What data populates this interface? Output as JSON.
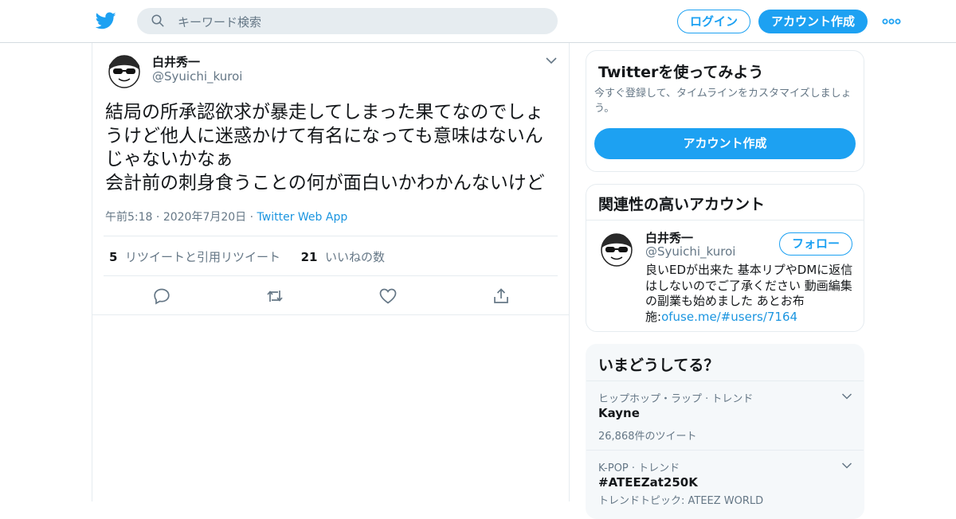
{
  "header": {
    "search_placeholder": "キーワード検索",
    "login_label": "ログイン",
    "signup_label": "アカウント作成"
  },
  "tweet": {
    "author_name": "白井秀一",
    "author_handle": "@Syuichi_kuroi",
    "text": "結局の所承認欲求が暴走してしまった果てなのでしょうけど他人に迷惑かけて有名になっても意味はないんじゃないかなぁ\n会計前の刺身食うことの何が面白いかわかんないけど",
    "time": "午前5:18",
    "date": "2020年7月20日",
    "source": "Twitter Web App",
    "retweet_count": "5",
    "retweet_label": "リツイートと引用リツイート",
    "like_count": "21",
    "like_label": "いいねの数"
  },
  "sidebar": {
    "signup_card": {
      "title": "Twitterを使ってみよう",
      "description": "今すぐ登録して、タイムラインをカスタマイズしましょう。",
      "button": "アカウント作成"
    },
    "related": {
      "title": "関連性の高いアカウント",
      "name": "白井秀一",
      "handle": "@Syuichi_kuroi",
      "follow_label": "フォロー",
      "bio": "良いEDが出来た 基本リプやDMに返信はしないのでご了承ください 動画編集の副業も始めました あとお布施:",
      "bio_link": "ofuse.me/#users/7164"
    },
    "trends": {
      "title": "いまどうしてる？",
      "items": [
        {
          "context": "ヒップホップ・ラップ · トレンド",
          "name": "Kayne",
          "count": "26,868件のツイート"
        },
        {
          "context": "K-POP · トレンド",
          "name": "#ATEEZat250K",
          "count": "トレンドトピック: ATEEZ WORLD"
        }
      ]
    }
  },
  "colors": {
    "brand_blue": "#1da1f2",
    "link_blue": "#1b95e0",
    "secondary_text": "#657786"
  },
  "icons": {
    "logo": "twitter-bird-icon",
    "search": "search-icon",
    "more": "more-dots-icon",
    "caret": "chevron-down-icon",
    "reply": "reply-icon",
    "retweet": "retweet-icon",
    "like": "heart-icon",
    "share": "share-icon"
  }
}
